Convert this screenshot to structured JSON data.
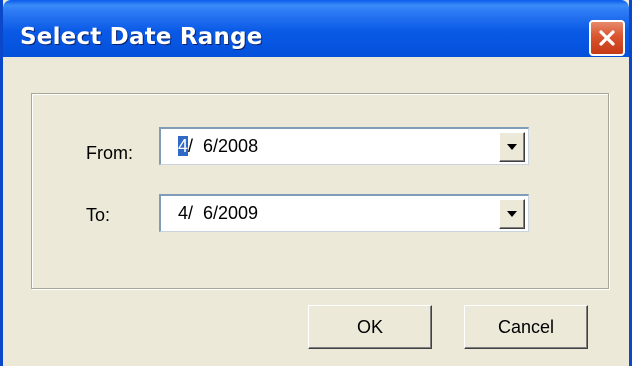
{
  "dialog": {
    "title": "Select Date Range",
    "close_icon": "close-icon"
  },
  "form": {
    "from_label": "From:",
    "from_value_selected": "4",
    "from_value_rest": "/  6/2008",
    "to_label": "To:",
    "to_value": "4/  6/2009",
    "dropdown_icon": "chevron-down-icon"
  },
  "buttons": {
    "ok_label": "OK",
    "cancel_label": "Cancel"
  },
  "colors": {
    "titlebar": "#0a5ae6",
    "close_button": "#d9542f",
    "dialog_background": "#ece9d8",
    "selection": "#316ac5"
  }
}
